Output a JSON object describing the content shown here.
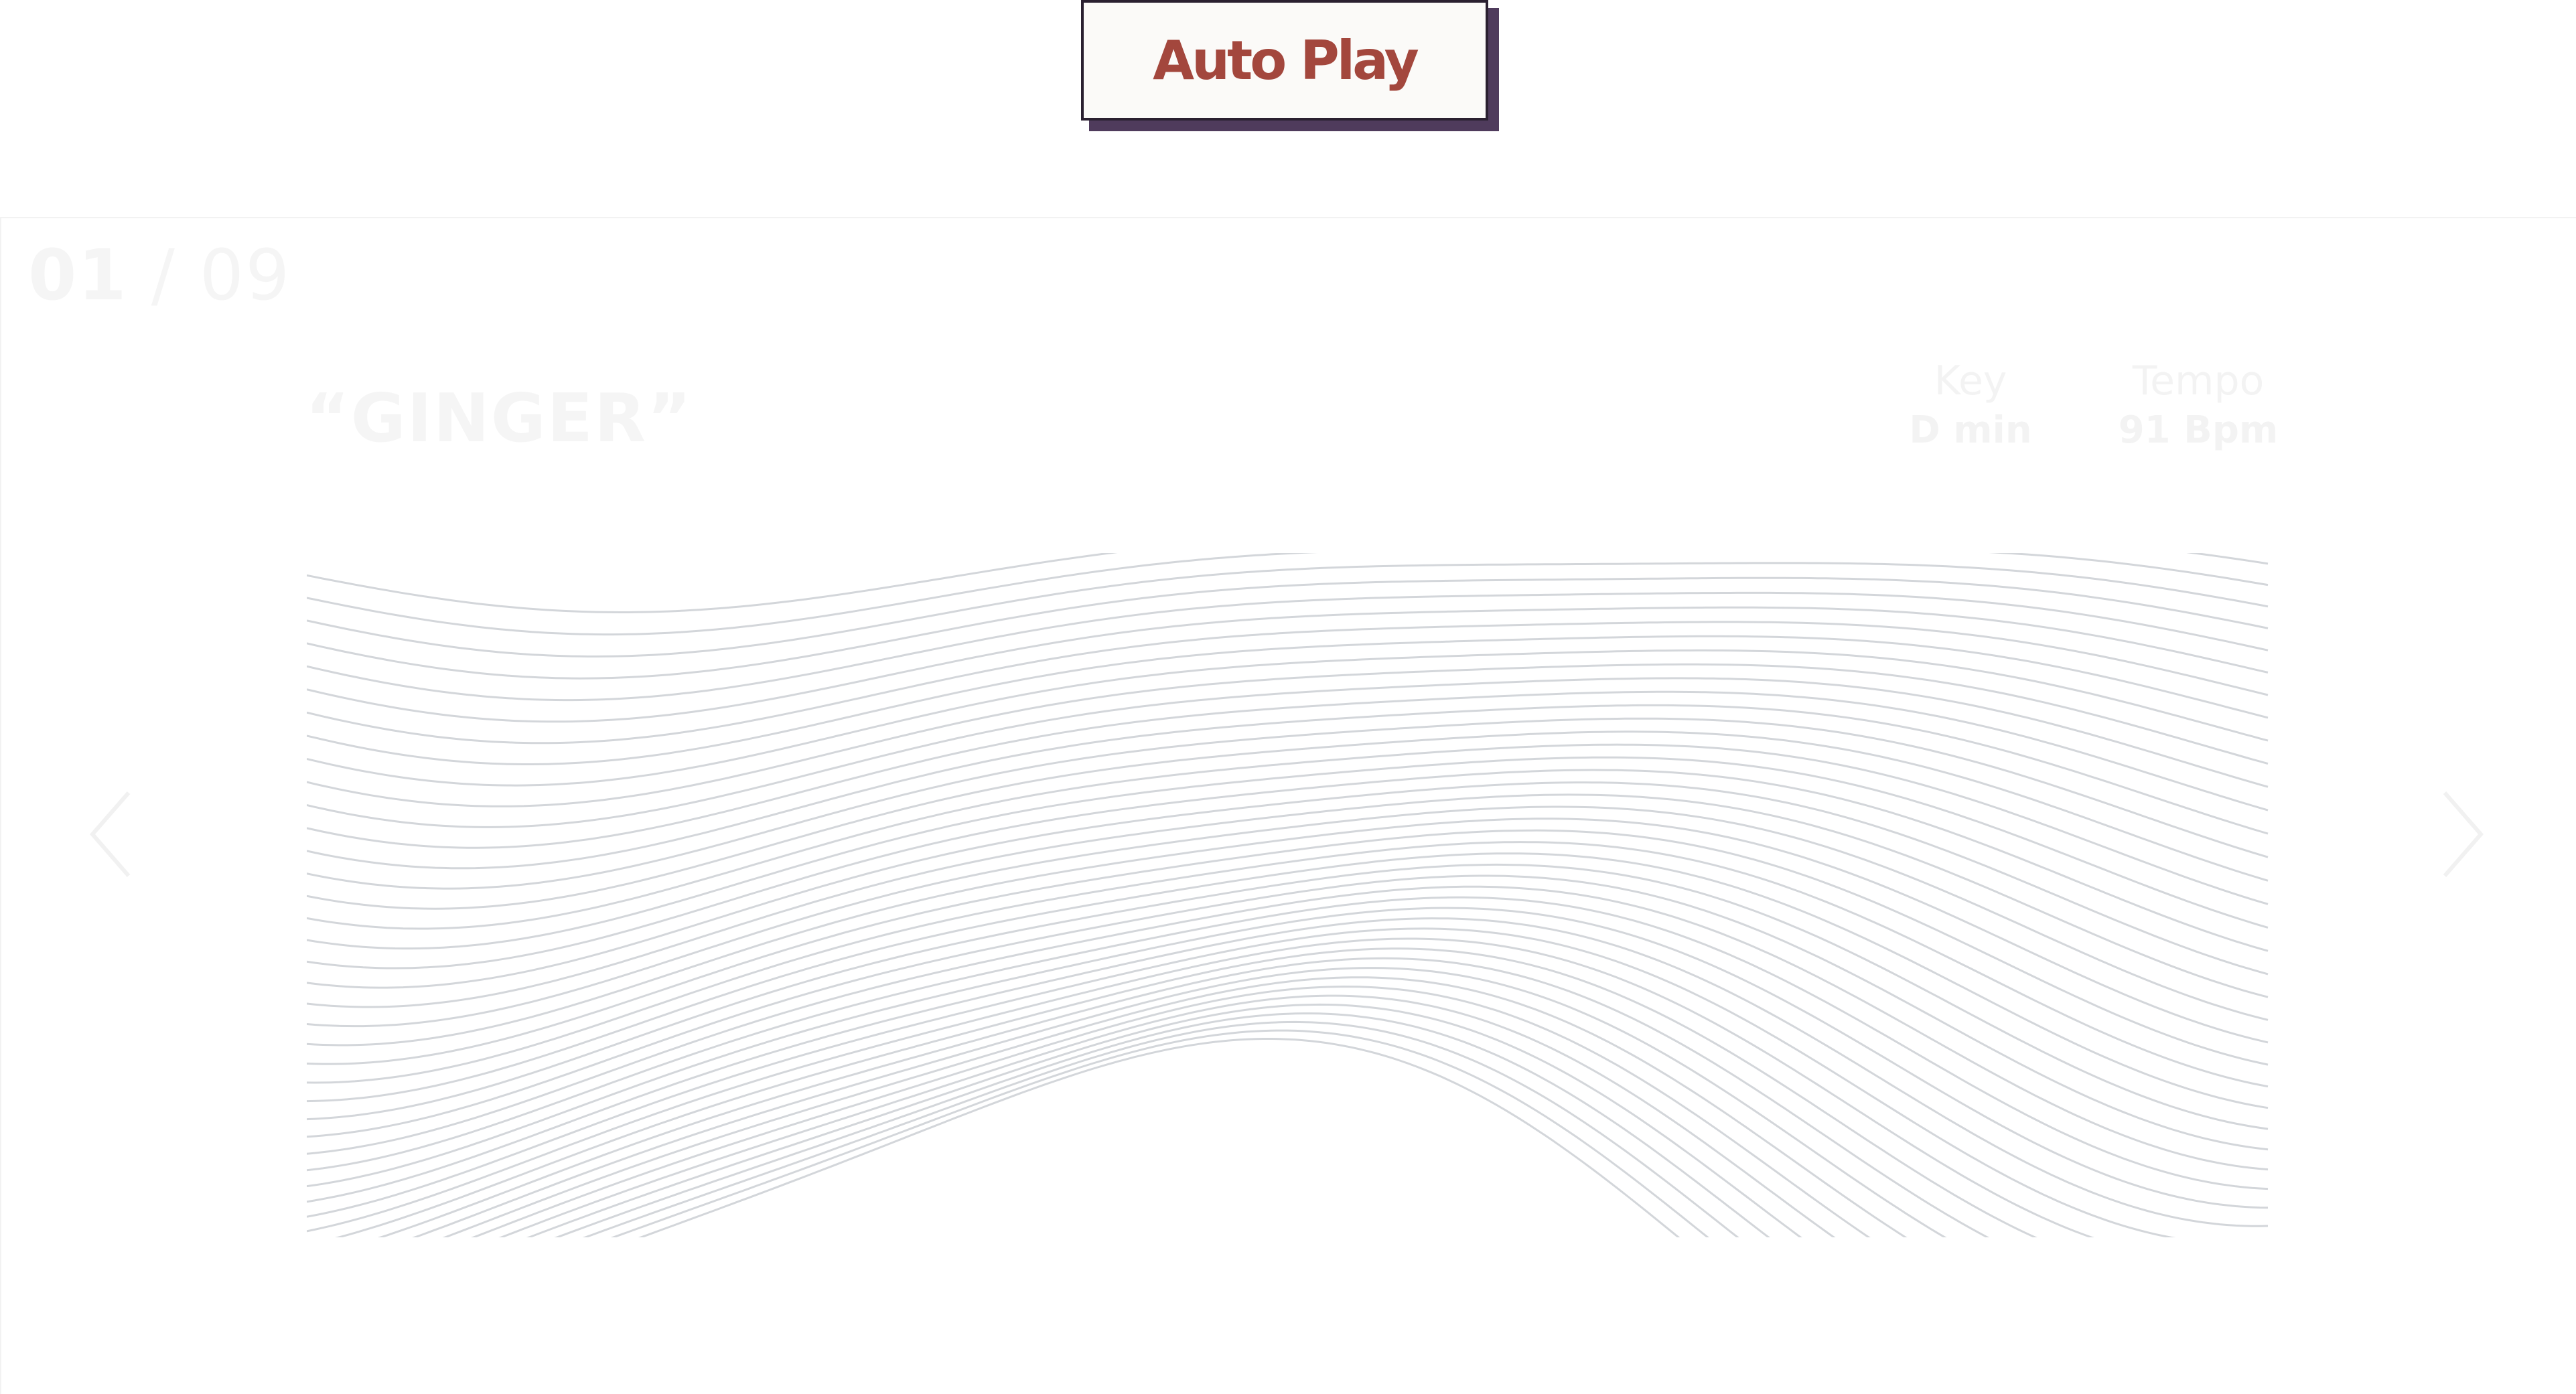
{
  "autoplay": {
    "label": "Auto Play"
  },
  "slider": {
    "current": "01",
    "separator": "/",
    "total": "09",
    "title": "“GINGER”",
    "key": {
      "label": "Key",
      "value": "D min"
    },
    "tempo": {
      "label": "Tempo",
      "value": "91 Bpm"
    }
  },
  "icons": {
    "prev": "chevron-left-icon",
    "next": "chevron-right-icon",
    "artwork": "wave-lines-artwork"
  },
  "colors": {
    "autoplay_text": "#a3473d",
    "autoplay_shadow": "#4f3b5c",
    "wave_lines": "#d3d6da",
    "faded_text": "#f5f5f5"
  }
}
